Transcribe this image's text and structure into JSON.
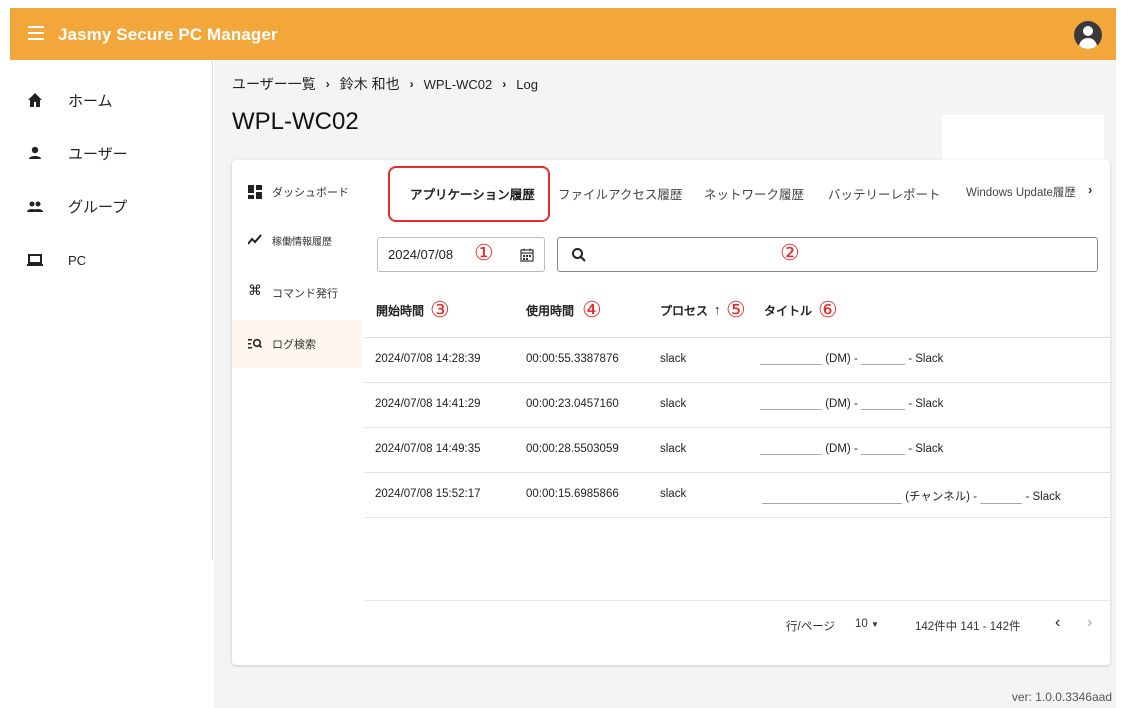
{
  "app": {
    "title": "Jasmy Secure PC Manager"
  },
  "sidebar": {
    "items": [
      {
        "label": "ホーム",
        "icon": "home-icon"
      },
      {
        "label": "ユーザー",
        "icon": "person-icon"
      },
      {
        "label": "グループ",
        "icon": "group-icon"
      },
      {
        "label": "PC",
        "icon": "laptop-icon"
      }
    ]
  },
  "breadcrumb": [
    "ユーザー一覧",
    "鈴木 和也",
    "WPL-WC02",
    "Log"
  ],
  "breadcrumb_sep": "›",
  "page": {
    "title": "WPL-WC02"
  },
  "subnav": {
    "items": [
      {
        "label": "ダッシュボード",
        "icon": "dashboard-icon"
      },
      {
        "label": "稼働情報履歴",
        "icon": "trend-icon"
      },
      {
        "label": "コマンド発行",
        "icon": "command-icon"
      },
      {
        "label": "ログ検索",
        "icon": "log-search-icon"
      }
    ],
    "active_index": 3
  },
  "tabs": [
    "アプリケーション履歴",
    "ファイルアクセス履歴",
    "ネットワーク履歴",
    "バッテリーレポート",
    "Windows Update履歴"
  ],
  "tabs_more": "›",
  "filters": {
    "date": "2024/07/08",
    "search_value": ""
  },
  "annotations": [
    "①",
    "②",
    "③",
    "④",
    "⑤",
    "⑥"
  ],
  "table": {
    "headers": [
      "開始時間",
      "使用時間",
      "プロセス",
      "タイトル"
    ],
    "sort_indicator": "↑",
    "rows": [
      {
        "start": "2024/07/08 14:28:39",
        "duration": "00:00:55.3387876",
        "process": "slack",
        "title_mid": "(DM) -",
        "title_end": "- Slack"
      },
      {
        "start": "2024/07/08 14:41:29",
        "duration": "00:00:23.0457160",
        "process": "slack",
        "title_mid": "(DM) -",
        "title_end": "- Slack"
      },
      {
        "start": "2024/07/08 14:49:35",
        "duration": "00:00:28.5503059",
        "process": "slack",
        "title_mid": "(DM) -",
        "title_end": "- Slack"
      },
      {
        "start": "2024/07/08 15:52:17",
        "duration": "00:00:15.6985866",
        "process": "slack",
        "title_mid": "(チャンネル) -",
        "title_end": "- Slack"
      }
    ]
  },
  "pager": {
    "rows_per_page_label": "行/ページ",
    "rows_per_page": "10",
    "range": "142件中 141 - 142件",
    "prev": "‹",
    "next": "›"
  },
  "footer": {
    "version": "ver: 1.0.0.3346aad"
  },
  "colors": {
    "accent": "#f3a63a",
    "highlight": "#e52b2b"
  }
}
